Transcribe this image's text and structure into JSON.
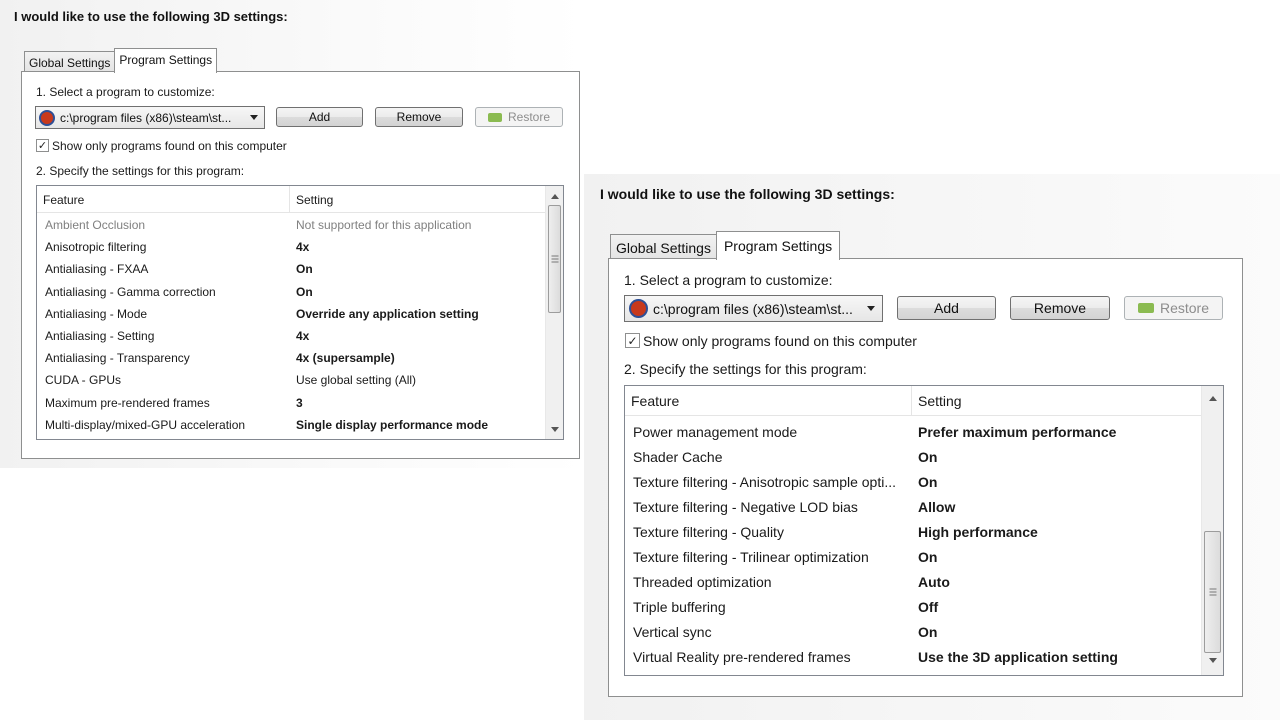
{
  "heading": "I would like to use the following 3D settings:",
  "tabs": [
    "Global Settings",
    "Program Settings"
  ],
  "select_label": "1. Select a program to customize:",
  "program_value": "c:\\program files (x86)\\steam\\st...",
  "buttons": {
    "add": "Add",
    "remove": "Remove",
    "restore": "Restore"
  },
  "checkbox": {
    "label": "Show only programs found on this computer",
    "checked": true
  },
  "specify_label": "2. Specify the settings for this program:",
  "columns": {
    "feature": "Feature",
    "setting": "Setting"
  },
  "panel1": {
    "rows": [
      {
        "feature": "Ambient Occlusion",
        "setting": "Not supported for this application",
        "style": "grey"
      },
      {
        "feature": "Anisotropic filtering",
        "setting": "4x",
        "style": "bold"
      },
      {
        "feature": "Antialiasing - FXAA",
        "setting": "On",
        "style": "bold"
      },
      {
        "feature": "Antialiasing - Gamma correction",
        "setting": "On",
        "style": "bold"
      },
      {
        "feature": "Antialiasing - Mode",
        "setting": "Override any application setting",
        "style": "bold"
      },
      {
        "feature": "Antialiasing - Setting",
        "setting": "4x",
        "style": "bold"
      },
      {
        "feature": "Antialiasing - Transparency",
        "setting": "4x (supersample)",
        "style": "bold"
      },
      {
        "feature": "CUDA - GPUs",
        "setting": "Use global setting (All)",
        "style": "normal"
      },
      {
        "feature": "Maximum pre-rendered frames",
        "setting": "3",
        "style": "bold"
      },
      {
        "feature": "Multi-display/mixed-GPU acceleration",
        "setting": "Single display performance mode",
        "style": "bold"
      }
    ]
  },
  "panel2": {
    "rows": [
      {
        "feature": "Power management mode",
        "setting": "Prefer maximum performance",
        "style": "bold"
      },
      {
        "feature": "Shader Cache",
        "setting": "On",
        "style": "bold"
      },
      {
        "feature": "Texture filtering - Anisotropic sample opti...",
        "setting": "On",
        "style": "bold"
      },
      {
        "feature": "Texture filtering - Negative LOD bias",
        "setting": "Allow",
        "style": "bold"
      },
      {
        "feature": "Texture filtering - Quality",
        "setting": "High performance",
        "style": "bold"
      },
      {
        "feature": "Texture filtering - Trilinear optimization",
        "setting": "On",
        "style": "bold"
      },
      {
        "feature": "Threaded optimization",
        "setting": "Auto",
        "style": "bold"
      },
      {
        "feature": "Triple buffering",
        "setting": "Off",
        "style": "bold"
      },
      {
        "feature": "Vertical sync",
        "setting": "On",
        "style": "bold"
      },
      {
        "feature": "Virtual Reality pre-rendered frames",
        "setting": "Use the 3D application setting",
        "style": "bold"
      }
    ]
  },
  "colors": {
    "app_icon_fill": "#c8391c",
    "app_icon_ring": "#2e4f96",
    "nvidia_green": "#8bbb51",
    "disabled_text": "#8d8d8d"
  },
  "icons": {
    "program": "app-icon",
    "restore": "nvidia-logo-icon",
    "dropdown": "chevron-down-icon"
  }
}
